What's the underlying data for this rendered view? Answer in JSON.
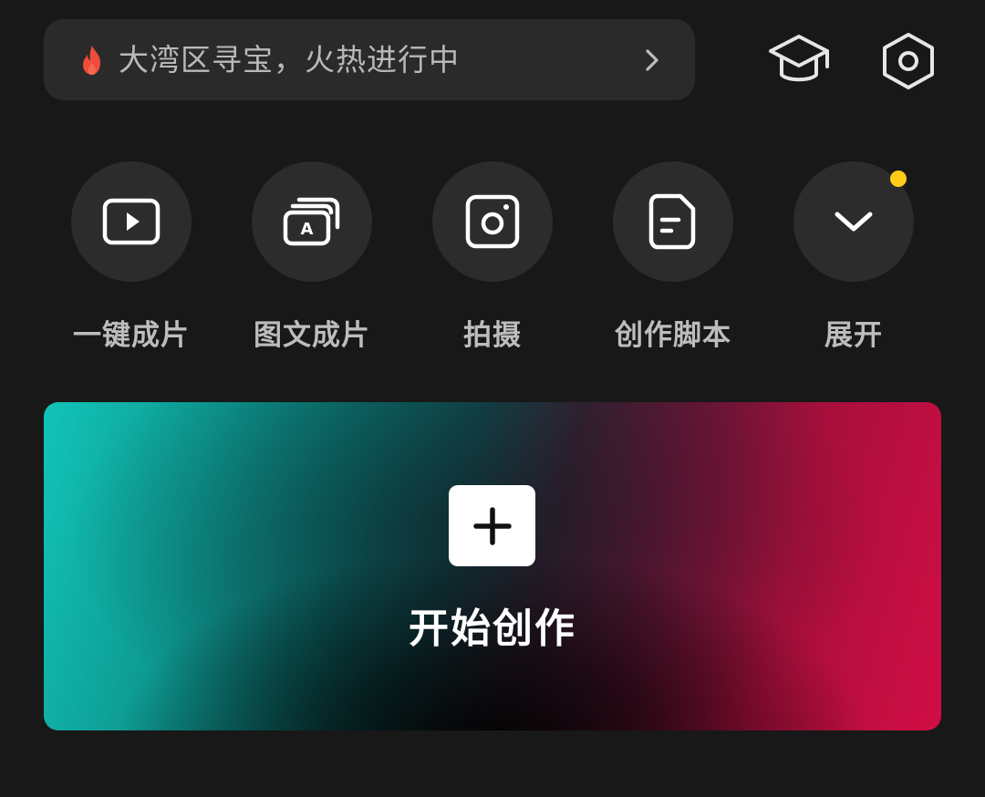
{
  "banner": {
    "text": "大湾区寻宝，火热进行中",
    "icon": "flame-icon",
    "flame_color": "#ef4b3c"
  },
  "top_icons": [
    {
      "name": "tutorial",
      "icon": "graduation-cap-icon"
    },
    {
      "name": "settings",
      "icon": "hexagon-settings-icon"
    }
  ],
  "actions": [
    {
      "label": "一键成片",
      "icon": "play-video-icon"
    },
    {
      "label": "图文成片",
      "icon": "text-to-video-icon"
    },
    {
      "label": "拍摄",
      "icon": "camera-icon"
    },
    {
      "label": "创作脚本",
      "icon": "script-document-icon"
    },
    {
      "label": "展开",
      "icon": "chevron-down-icon",
      "badge": "new-dot"
    }
  ],
  "create": {
    "label": "开始创作",
    "icon": "plus-icon"
  },
  "colors": {
    "background": "#181818",
    "surface": "#2a2a2a",
    "badge": "#ffcc1a",
    "gradient_left": "#12c4b8",
    "gradient_right": "#d10d45"
  }
}
